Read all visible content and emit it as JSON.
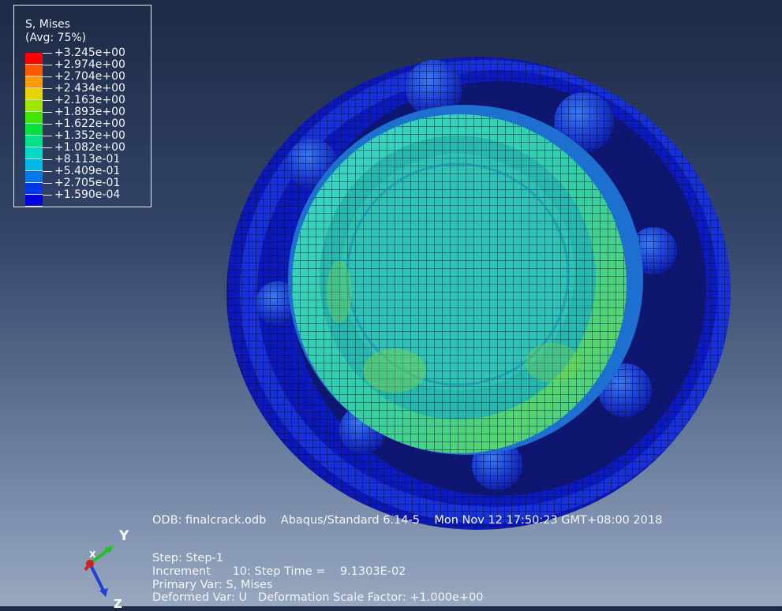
{
  "legend": {
    "title": "S, Mises",
    "subtitle": "(Avg: 75%)",
    "entries": [
      {
        "label": "+3.245e+00",
        "color": "#ff0000"
      },
      {
        "label": "+2.974e+00",
        "color": "#ff5a00"
      },
      {
        "label": "+2.704e+00",
        "color": "#ff9a00"
      },
      {
        "label": "+2.434e+00",
        "color": "#e6d400"
      },
      {
        "label": "+2.163e+00",
        "color": "#9fe600"
      },
      {
        "label": "+1.893e+00",
        "color": "#3ee600"
      },
      {
        "label": "+1.622e+00",
        "color": "#00e33a"
      },
      {
        "label": "+1.352e+00",
        "color": "#00e28a"
      },
      {
        "label": "+1.082e+00",
        "color": "#00dcc3"
      },
      {
        "label": "+8.113e-01",
        "color": "#00b8e6"
      },
      {
        "label": "+5.409e-01",
        "color": "#0077e8"
      },
      {
        "label": "+2.705e-01",
        "color": "#0038e6"
      },
      {
        "label": "+1.590e-04",
        "color": "#0000e0"
      }
    ]
  },
  "header_line": "ODB: finalcrack.odb    Abaqus/Standard 6.14-5    Mon Nov 12 17:50:23 GMT+08:00 2018",
  "step_info": {
    "step": "Step: Step-1",
    "increment": "Increment      10: Step Time =    9.1303E-02",
    "primary_var": "Primary Var: S, Mises",
    "deformed_var": "Deformed Var: U   Deformation Scale Factor: +1.000e+00"
  },
  "triad": {
    "y_label": "Y",
    "x_label": "X",
    "z_label": "Z"
  },
  "colors": {
    "outer_ring": "#1020c8",
    "inner_ring": "#2fd0b0",
    "ball": "#1e3fd8",
    "mesh": "#0a0f40"
  }
}
